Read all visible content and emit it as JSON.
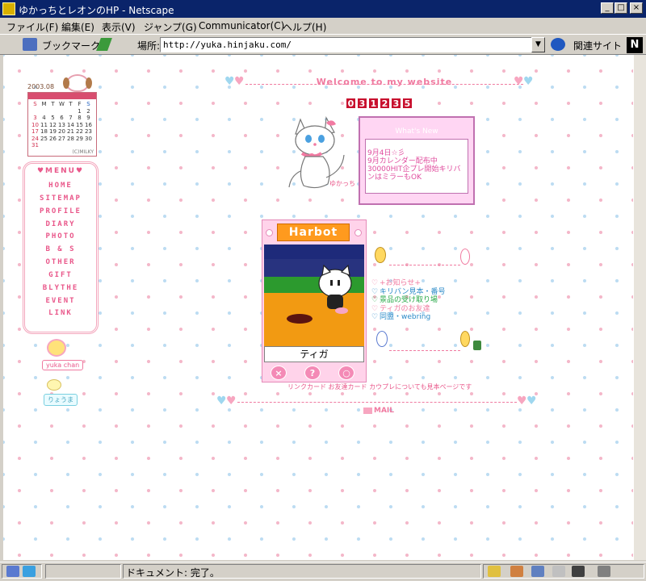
{
  "window": {
    "title": "ゆかっちとレオンのHP - Netscape",
    "buttons": [
      "_",
      "□",
      "×"
    ]
  },
  "menubar": [
    "ファイル(F)",
    "編集(E)",
    "表示(V)",
    "ジャンプ(G)",
    "Communicator(C)",
    "ヘルプ(H)"
  ],
  "toolbar": {
    "bookmark_label": "ブックマーク",
    "location_label": "場所:",
    "url": "http://yuka.hinjaku.com/",
    "related_label": "関連サイト",
    "netscape_logo": "N"
  },
  "sidebar": {
    "calendar": {
      "month_label": "2003.08",
      "weekdays": [
        "S",
        "M",
        "T",
        "W",
        "T",
        "F",
        "S"
      ],
      "days": [
        "",
        "",
        "",
        "",
        "",
        "1",
        "2",
        "3",
        "4",
        "5",
        "6",
        "7",
        "8",
        "9",
        "10",
        "11",
        "12",
        "13",
        "14",
        "15",
        "16",
        "17",
        "18",
        "19",
        "20",
        "21",
        "22",
        "23",
        "24",
        "25",
        "26",
        "27",
        "28",
        "29",
        "30",
        "31",
        "",
        "",
        "",
        "",
        "",
        ""
      ],
      "credit": "(C)MILKY"
    },
    "menu_title": "♥MENU♥",
    "menu_items": [
      "HOME",
      "SITEMAP",
      "PROFILE",
      "DIARY",
      "PHOTO",
      "B & S",
      "OTHER",
      "GIFT",
      "BLYTHE",
      "EVENT",
      "LINK"
    ],
    "badges": [
      "yuka chan",
      "りょうま"
    ]
  },
  "main": {
    "welcome": "Welcome to my website",
    "counter": [
      "0",
      "3",
      "1",
      "2",
      "3",
      "5"
    ],
    "cat_credit": "ゆかっち",
    "news": {
      "title": "What's New",
      "lines": [
        "9月4日☆彡",
        "9月カレンダー配布中",
        "30000HIT企プレ開始キリバ",
        "ンはミラーもOK"
      ]
    },
    "harbot": {
      "logo": "Harbot",
      "name": "ティガ",
      "buttons": [
        "×",
        "?",
        "○"
      ]
    },
    "links": [
      {
        "text": "+お知らせ+",
        "color": "#f07aa0"
      },
      {
        "text": "キリバン見本・番号",
        "color": "#2a8ac8"
      },
      {
        "text": "景品の受け取り場",
        "color": "#28a848"
      },
      {
        "text": "ティガのお友達",
        "color": "#f07aa0"
      },
      {
        "text": "同盟・webring",
        "color": "#2a8ac8"
      }
    ],
    "footer_note": "リンクカード お友達カード カウプレについても見本ページです",
    "mail_label": "MAIL"
  },
  "statusbar": {
    "text": "ドキュメント: 完了。"
  }
}
